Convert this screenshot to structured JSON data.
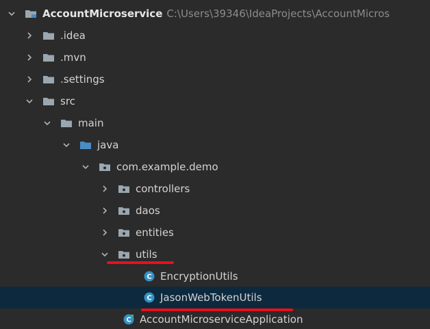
{
  "project": {
    "name": "AccountMicroservice",
    "path": "C:\\Users\\39346\\IdeaProjects\\AccountMicros"
  },
  "nodes": {
    "idea": {
      "label": ".idea"
    },
    "mvn": {
      "label": ".mvn"
    },
    "settings": {
      "label": ".settings"
    },
    "src": {
      "label": "src"
    },
    "main": {
      "label": "main"
    },
    "java": {
      "label": "java"
    },
    "package": {
      "label": "com.example.demo"
    },
    "controllers": {
      "label": "controllers"
    },
    "daos": {
      "label": "daos"
    },
    "entities": {
      "label": "entities"
    },
    "utils": {
      "label": "utils"
    },
    "encryption_utils": {
      "label": "EncryptionUtils"
    },
    "jason_web_token_utils": {
      "label": "JasonWebTokenUtils"
    },
    "application": {
      "label": "AccountMicroserviceApplication"
    }
  },
  "colors": {
    "background": "#2b2b2b",
    "selection": "#0d293e",
    "folder": "#9aa7b0",
    "source_folder": "#4a8bc8",
    "class_icon": "#3592c4",
    "highlight_underline": "#e8101b"
  },
  "icons": {
    "expand": "chevron-right-icon",
    "collapse": "chevron-down-icon",
    "folder": "folder-icon",
    "package": "package-folder-icon",
    "class": "class-icon"
  }
}
